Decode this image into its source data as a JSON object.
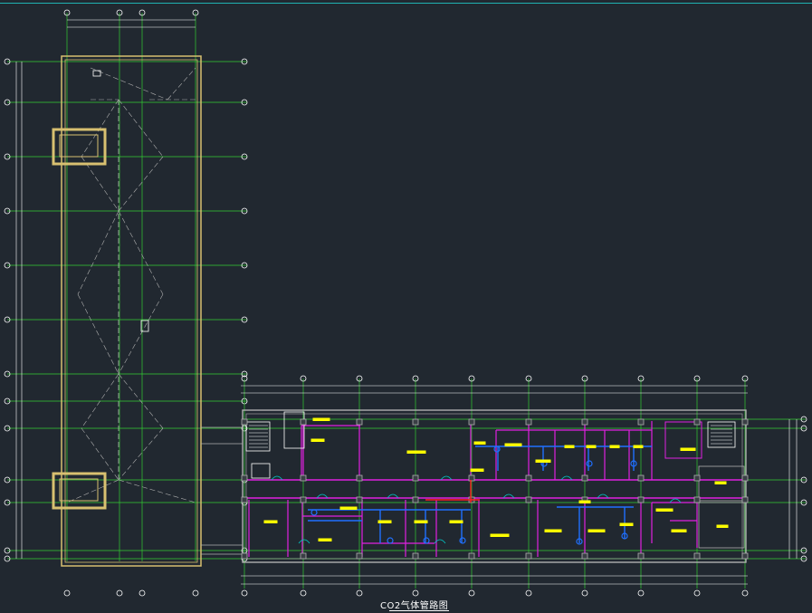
{
  "drawing": {
    "title": "CO2气体管路图",
    "colors": {
      "background": "#212830",
      "grid": "#33cc33",
      "wall": "#b0b0b0",
      "partition": "#e020e0",
      "column": "#d8c070",
      "pipe": "#2070ff",
      "pipe_red": "#ff2020",
      "dim": "#ffffff",
      "label": "#ffff00",
      "cyan": "#00c8c8"
    }
  }
}
